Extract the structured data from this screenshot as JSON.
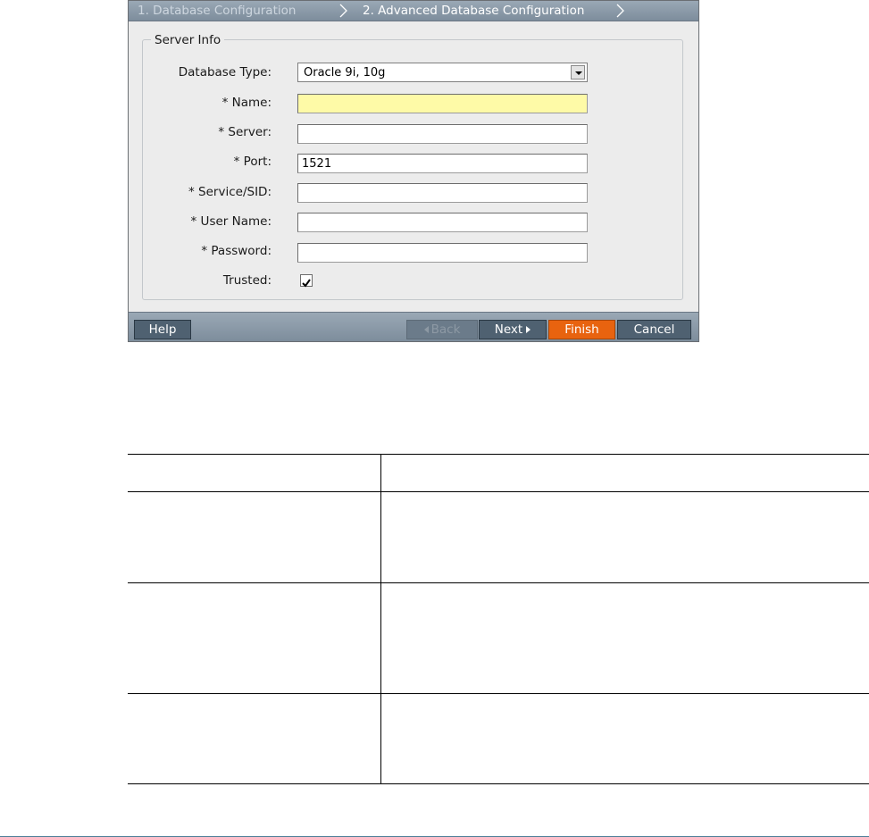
{
  "wizard": {
    "steps": [
      "1. Database Configuration",
      "2. Advanced Database Configuration"
    ]
  },
  "server_info": {
    "legend": "Server Info",
    "fields": [
      {
        "label": "Database Type:",
        "value": "Oracle 9i, 10g"
      },
      {
        "label": "* Name:",
        "value": ""
      },
      {
        "label": "* Server:",
        "value": ""
      },
      {
        "label": "* Port:",
        "value": "1521"
      },
      {
        "label": "* Service/SID:",
        "value": ""
      },
      {
        "label": "* User Name:",
        "value": ""
      },
      {
        "label": "* Password:",
        "value": ""
      },
      {
        "label": "Trusted:",
        "checked": true
      }
    ]
  },
  "buttons": {
    "help": "Help",
    "back": "Back",
    "next": "Next",
    "finish": "Finish",
    "cancel": "Cancel"
  },
  "colors": {
    "bar": "#8696a5",
    "button": "#4f6171",
    "finish": "#e8630f",
    "highlight_field": "#fefaa7"
  },
  "table": {
    "headers": [
      "",
      ""
    ],
    "rows": [
      [
        "",
        ""
      ],
      [
        "",
        ""
      ],
      [
        "",
        ""
      ]
    ]
  }
}
